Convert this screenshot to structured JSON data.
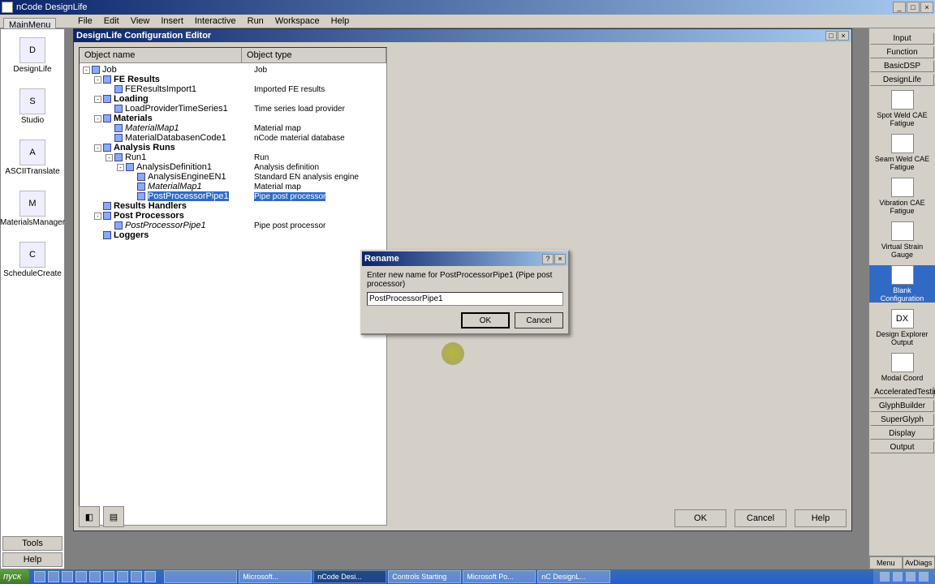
{
  "app": {
    "title": "nCode DesignLife"
  },
  "window_controls": {
    "min": "_",
    "max": "□",
    "close": "×"
  },
  "mainmenu": {
    "label": "MainMenu"
  },
  "menubar": {
    "items": [
      "File",
      "Edit",
      "View",
      "Insert",
      "Interactive",
      "Run",
      "Workspace",
      "Help"
    ]
  },
  "left_tools": {
    "items": [
      {
        "label": "DesignLife",
        "glyph": "D"
      },
      {
        "label": "Studio",
        "glyph": "S"
      },
      {
        "label": "ASCIITranslate",
        "glyph": "A"
      },
      {
        "label": "MaterialsManager",
        "glyph": "M"
      },
      {
        "label": "ScheduleCreate",
        "glyph": "C"
      }
    ],
    "bottom": {
      "tools": "Tools",
      "help": "Help"
    }
  },
  "config_editor": {
    "title": "DesignLife Configuration Editor",
    "columns": {
      "name": "Object name",
      "type": "Object type"
    },
    "tree": [
      {
        "indent": 0,
        "exp": "-",
        "name": "Job",
        "type": "Job",
        "bold": false
      },
      {
        "indent": 1,
        "exp": "-",
        "name": "FE Results",
        "type": "",
        "bold": true
      },
      {
        "indent": 2,
        "exp": "",
        "name": "FEResultsImport1",
        "type": "Imported FE results",
        "bold": false
      },
      {
        "indent": 1,
        "exp": "-",
        "name": "Loading",
        "type": "",
        "bold": true
      },
      {
        "indent": 2,
        "exp": "",
        "name": "LoadProviderTimeSeries1",
        "type": "Time series load provider",
        "bold": false
      },
      {
        "indent": 1,
        "exp": "-",
        "name": "Materials",
        "type": "",
        "bold": true
      },
      {
        "indent": 2,
        "exp": "",
        "name": "MaterialMap1",
        "type": "Material map",
        "bold": false,
        "italic": true
      },
      {
        "indent": 2,
        "exp": "",
        "name": "MaterialDatabasenCode1",
        "type": "nCode material database",
        "bold": false
      },
      {
        "indent": 1,
        "exp": "-",
        "name": "Analysis Runs",
        "type": "",
        "bold": true
      },
      {
        "indent": 2,
        "exp": "-",
        "name": "Run1",
        "type": "Run",
        "bold": false
      },
      {
        "indent": 3,
        "exp": "-",
        "name": "AnalysisDefinition1",
        "type": "Analysis definition",
        "bold": false
      },
      {
        "indent": 4,
        "exp": "",
        "name": "AnalysisEngineEN1",
        "type": "Standard EN analysis engine",
        "bold": false
      },
      {
        "indent": 4,
        "exp": "",
        "name": "MaterialMap1",
        "type": "Material map",
        "bold": false,
        "italic": true
      },
      {
        "indent": 4,
        "exp": "",
        "name": "PostProcessorPipe1",
        "type": "Pipe post processor",
        "bold": false,
        "selected": true
      },
      {
        "indent": 1,
        "exp": "",
        "name": "Results Handlers",
        "type": "",
        "bold": true
      },
      {
        "indent": 1,
        "exp": "-",
        "name": "Post Processors",
        "type": "",
        "bold": true
      },
      {
        "indent": 2,
        "exp": "",
        "name": "PostProcessorPipe1",
        "type": "Pipe post processor",
        "bold": false,
        "italic": true
      },
      {
        "indent": 1,
        "exp": "",
        "name": "Loggers",
        "type": "",
        "bold": true
      }
    ],
    "footer": {
      "ok": "OK",
      "cancel": "Cancel",
      "help": "Help"
    }
  },
  "rename_dialog": {
    "title": "Rename",
    "label": "Enter new name for PostProcessorPipe1 (Pipe post processor)",
    "value": "PostProcessorPipe1",
    "ok": "OK",
    "cancel": "Cancel"
  },
  "right_palette": {
    "headers": [
      "Input",
      "Function",
      "BasicDSP",
      "DesignLife"
    ],
    "items": [
      {
        "label": "Spot Weld CAE Fatigue",
        "glyph": ""
      },
      {
        "label": "Seam Weld CAE Fatigue",
        "glyph": ""
      },
      {
        "label": "Vibration CAE Fatigue",
        "glyph": ""
      },
      {
        "label": "Virtual Strain Gauge",
        "glyph": ""
      },
      {
        "label": "Blank Configuration",
        "glyph": "",
        "selected": true
      },
      {
        "label": "Design Explorer Output",
        "glyph": "DX"
      },
      {
        "label": "Modal Coord",
        "glyph": ""
      }
    ],
    "footers": [
      "AcceleratedTesting",
      "GlyphBuilder",
      "SuperGlyph",
      "Display",
      "Output"
    ],
    "bottom_tabs": [
      "Menu",
      "AvDiags"
    ]
  },
  "taskbar": {
    "start": "пуск",
    "tasks": [
      "",
      "Microsoft...",
      "nCode Desi...",
      "Controls Starting",
      "Microsoft Po...",
      "nC DesignL..."
    ]
  }
}
